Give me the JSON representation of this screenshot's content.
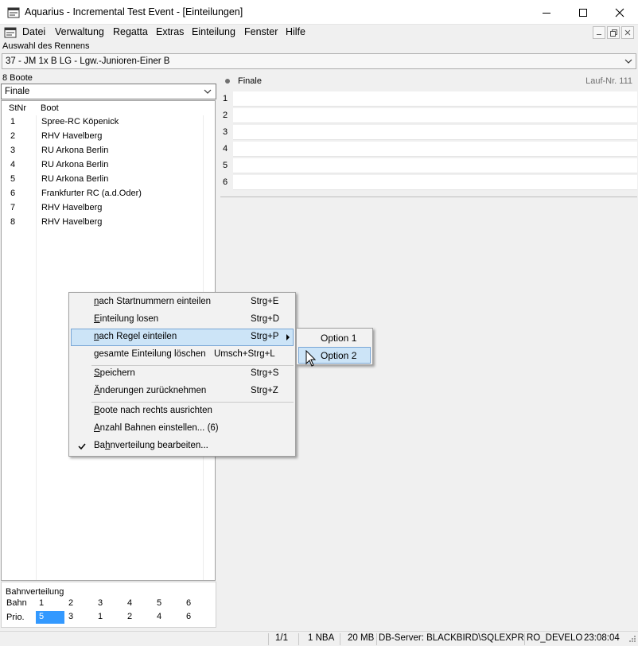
{
  "window": {
    "title": "Aquarius - Incremental Test Event - [Einteilungen]",
    "minimize_icon": "minimize-icon",
    "maximize_icon": "maximize-icon",
    "close_icon": "close-icon"
  },
  "menu": {
    "items": [
      "Datei",
      "Verwaltung",
      "Regatta",
      "Extras",
      "Einteilung",
      "Fenster",
      "Hilfe"
    ]
  },
  "race_selector": {
    "label": "Auswahl des Rennens",
    "value": "37 - JM 1x B LG - Lgw.-Junioren-Einer B"
  },
  "left_panel": {
    "boats_count": "8 Boote",
    "round": "Finale",
    "columns": {
      "stnr": "StNr",
      "boot": "Boot"
    },
    "boats": [
      {
        "nr": "1",
        "name": "Spree-RC Köpenick"
      },
      {
        "nr": "2",
        "name": "RHV Havelberg"
      },
      {
        "nr": "3",
        "name": "RU Arkona Berlin"
      },
      {
        "nr": "4",
        "name": "RU Arkona Berlin"
      },
      {
        "nr": "5",
        "name": "RU Arkona Berlin"
      },
      {
        "nr": "6",
        "name": "Frankfurter RC (a.d.Oder)"
      },
      {
        "nr": "7",
        "name": "RHV Havelberg"
      },
      {
        "nr": "8",
        "name": "RHV Havelberg"
      }
    ]
  },
  "lane_distribution": {
    "title": "Bahnverteilung",
    "bahn_label": "Bahn",
    "prio_label": "Prio.",
    "bahn": [
      "1",
      "2",
      "3",
      "4",
      "5",
      "6"
    ],
    "prio": [
      "5",
      "3",
      "1",
      "2",
      "4",
      "6"
    ]
  },
  "heat": {
    "name": "Finale",
    "lauf_nr": "Lauf-Nr. 111",
    "lanes": [
      "1",
      "2",
      "3",
      "4",
      "5",
      "6"
    ]
  },
  "context_menu": {
    "items": [
      {
        "label": "nach Startnummern einteilen",
        "ul": "n",
        "shortcut": "Strg+E"
      },
      {
        "label": "Einteilung losen",
        "ul": "E",
        "shortcut": "Strg+D"
      },
      {
        "label": "nach Regel einteilen",
        "ul": "n",
        "shortcut": "Strg+P",
        "submenu": true
      },
      {
        "label": "gesamte Einteilung löschen",
        "ul": "g",
        "shortcut": "Umsch+Strg+L"
      },
      {
        "label": "Speichern",
        "ul": "S",
        "shortcut": "Strg+S"
      },
      {
        "label": "Änderungen zurücknehmen",
        "ul": "Ä",
        "shortcut": "Strg+Z"
      },
      {
        "label": "Boote nach rechts ausrichten",
        "ul": "B",
        "shortcut": ""
      },
      {
        "label": "Anzahl Bahnen einstellen... (6)",
        "ul": "A",
        "shortcut": ""
      },
      {
        "label": "Bahnverteilung bearbeiten...",
        "ul": "h",
        "shortcut": "",
        "checked": true
      }
    ]
  },
  "submenu": {
    "items": [
      "Option 1",
      "Option 2"
    ]
  },
  "statusbar": {
    "page": "1/1",
    "nba": "1 NBA",
    "memory": "20 MB",
    "db_server": "DB-Server: BLACKBIRD\\SQLEXPRES",
    "db_name": "RO_DEVELOP",
    "time": "23:08:04"
  }
}
